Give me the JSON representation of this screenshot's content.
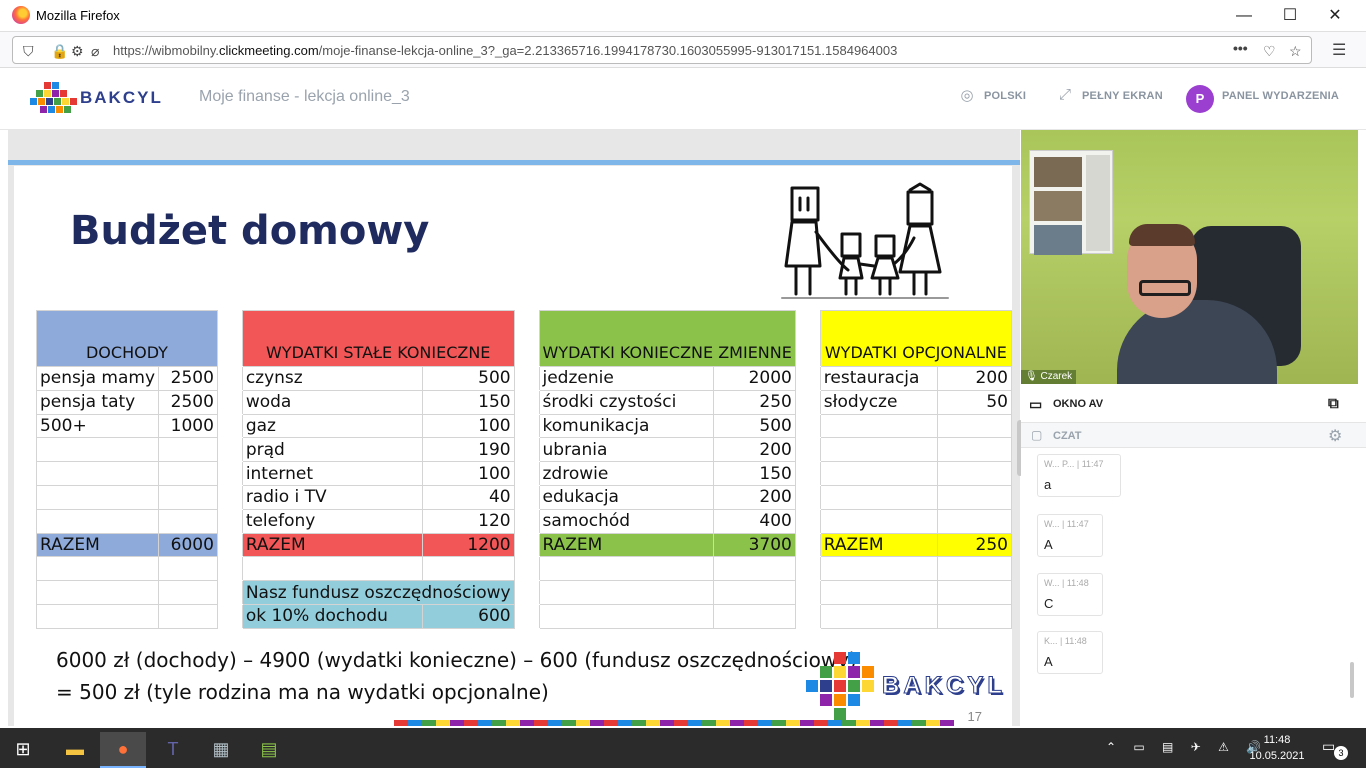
{
  "window": {
    "title": "Mozilla Firefox",
    "minimize": "—",
    "maximize": "☐",
    "close": "✕"
  },
  "browser": {
    "url_prefix": "https://wibmobilny.",
    "url_domain": "clickmeeting.com",
    "url_rest": "/moje-finanse-lekcja-online_3?_ga=2.213365716.1994178730.1603055995-913017151.1584964003"
  },
  "app": {
    "logo_text": "BAKCYL",
    "meeting_title": "Moje finanse - lekcja online_3",
    "language": "POLSKI",
    "fullscreen": "PEŁNY EKRAN",
    "avatar_letter": "P",
    "panel": "PANEL WYDARZENIA"
  },
  "slide": {
    "title": "Budżet domowy",
    "headers": {
      "income": "DOCHODY",
      "fixed": "WYDATKI STAŁE KONIECZNE",
      "variable": "WYDATKI KONIECZNE ZMIENNE",
      "optional": "WYDATKI OPCJONALNE"
    },
    "income": [
      [
        "pensja mamy",
        "2500"
      ],
      [
        "pensja taty",
        "2500"
      ],
      [
        "500+",
        "1000"
      ],
      [
        "",
        ""
      ],
      [
        "",
        ""
      ],
      [
        "",
        ""
      ],
      [
        "",
        ""
      ]
    ],
    "fixed": [
      [
        "czynsz",
        "500"
      ],
      [
        "woda",
        "150"
      ],
      [
        "gaz",
        "100"
      ],
      [
        "prąd",
        "190"
      ],
      [
        "internet",
        "100"
      ],
      [
        "radio i TV",
        "40"
      ],
      [
        "telefony",
        "120"
      ]
    ],
    "variable": [
      [
        "jedzenie",
        "2000"
      ],
      [
        "środki czystości",
        "250"
      ],
      [
        "komunikacja",
        "500"
      ],
      [
        "ubrania",
        "200"
      ],
      [
        "zdrowie",
        "150"
      ],
      [
        "edukacja",
        "200"
      ],
      [
        "samochód",
        "400"
      ]
    ],
    "optional": [
      [
        "restauracja",
        "200"
      ],
      [
        "słodycze",
        "50"
      ],
      [
        "",
        ""
      ],
      [
        "",
        ""
      ],
      [
        "",
        ""
      ],
      [
        "",
        ""
      ],
      [
        "",
        ""
      ]
    ],
    "totals": {
      "label": "RAZEM",
      "income": "6000",
      "fixed": "1200",
      "variable": "3700",
      "optional": "250"
    },
    "savings": {
      "line1": "Nasz fundusz oszczędnościowy",
      "line2": "ok 10% dochodu",
      "value": "600"
    },
    "formula_line1": "6000 zł (dochody) – 4900 (wydatki konieczne) – 600 (fundusz oszczędnościowy)",
    "formula_line2": "= 500 zł (tyle rodzina ma na wydatki opcjonalne)",
    "logo_text": "BAKCYL",
    "page_number": "17"
  },
  "video": {
    "participant": "Czarek"
  },
  "panels": {
    "av_window": "OKNO AV",
    "chat": "CZAT"
  },
  "chat": [
    {
      "author": "W... P...",
      "time": "11:47",
      "text": "a"
    },
    {
      "author": "W...",
      "time": "11:47",
      "text": "A"
    },
    {
      "author": "W...",
      "time": "11:48",
      "text": "C"
    },
    {
      "author": "K...",
      "time": "11:48",
      "text": "A"
    }
  ],
  "taskbar": {
    "time": "11:48",
    "date": "10.05.2021",
    "notifications": "3"
  },
  "colors": {
    "income": "#8eaadb",
    "fixed": "#f25656",
    "variable": "#8bc34a",
    "optional": "#ffff00",
    "savings": "#92cddc",
    "title": "#1f2b5f",
    "accent": "#9b3fd1"
  }
}
